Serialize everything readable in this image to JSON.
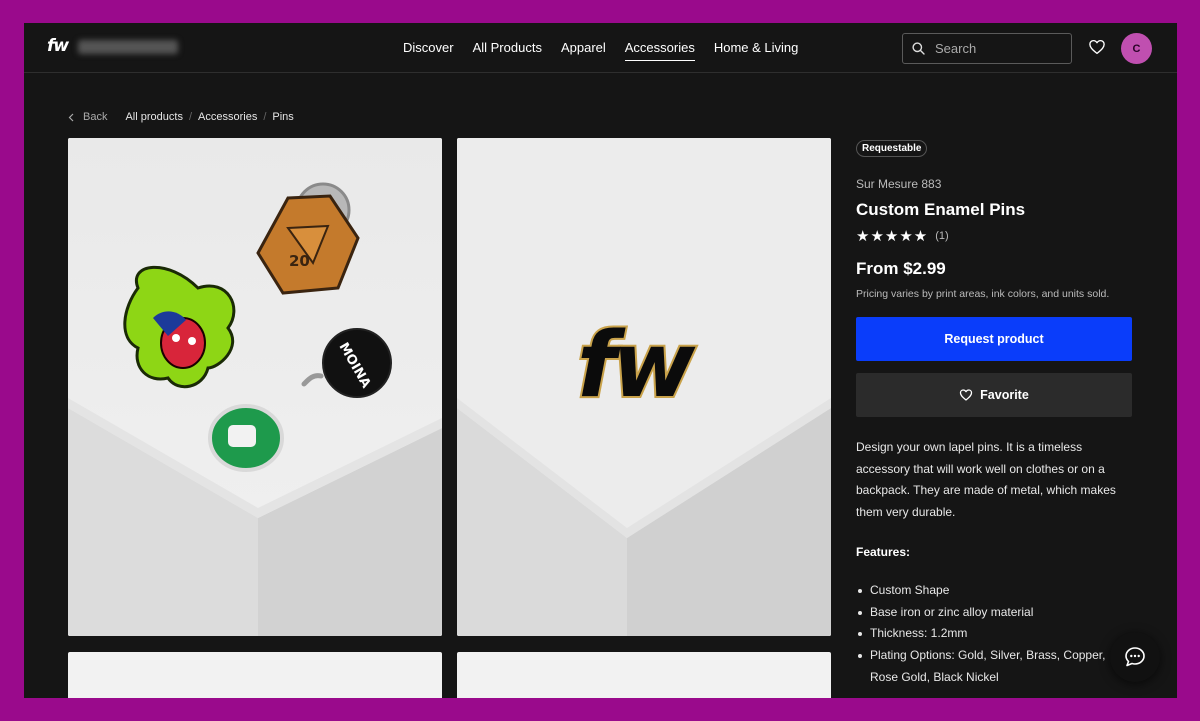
{
  "header": {
    "logo": "fw",
    "nav": [
      "Discover",
      "All Products",
      "Apparel",
      "Accessories",
      "Home & Living"
    ],
    "active_nav": "Accessories",
    "search_placeholder": "Search",
    "avatar_initial": "C"
  },
  "breadcrumb": {
    "back": "Back",
    "items": [
      "All products",
      "Accessories",
      "Pins"
    ]
  },
  "gallery": {
    "pin_text": "fw",
    "die_number": "20",
    "bomb_text": "MOINA"
  },
  "product": {
    "badge": "Requestable",
    "vendor": "Sur Mesure 883",
    "title": "Custom Enamel Pins",
    "stars": "★★★★★",
    "rating": 5,
    "review_count": "(1)",
    "price": "From $2.99",
    "price_note": "Pricing varies by print areas, ink colors, and units sold.",
    "request_button": "Request product",
    "favorite_button": "Favorite",
    "description": "Design your own lapel pins. It is a timeless accessory that will work well on clothes or on a backpack. They are made of metal, which makes them very durable.",
    "features_title": "Features:",
    "features": [
      "Custom Shape",
      "Base iron or zinc alloy material",
      "Thickness: 1.2mm",
      "Plating Options: Gold, Silver, Brass, Copper, Rose Gold, Black Nickel"
    ]
  },
  "colors": {
    "background": "#151515",
    "frame": "#9a0a8c",
    "primary": "#0a3dfa",
    "avatar": "#c04fb0"
  }
}
